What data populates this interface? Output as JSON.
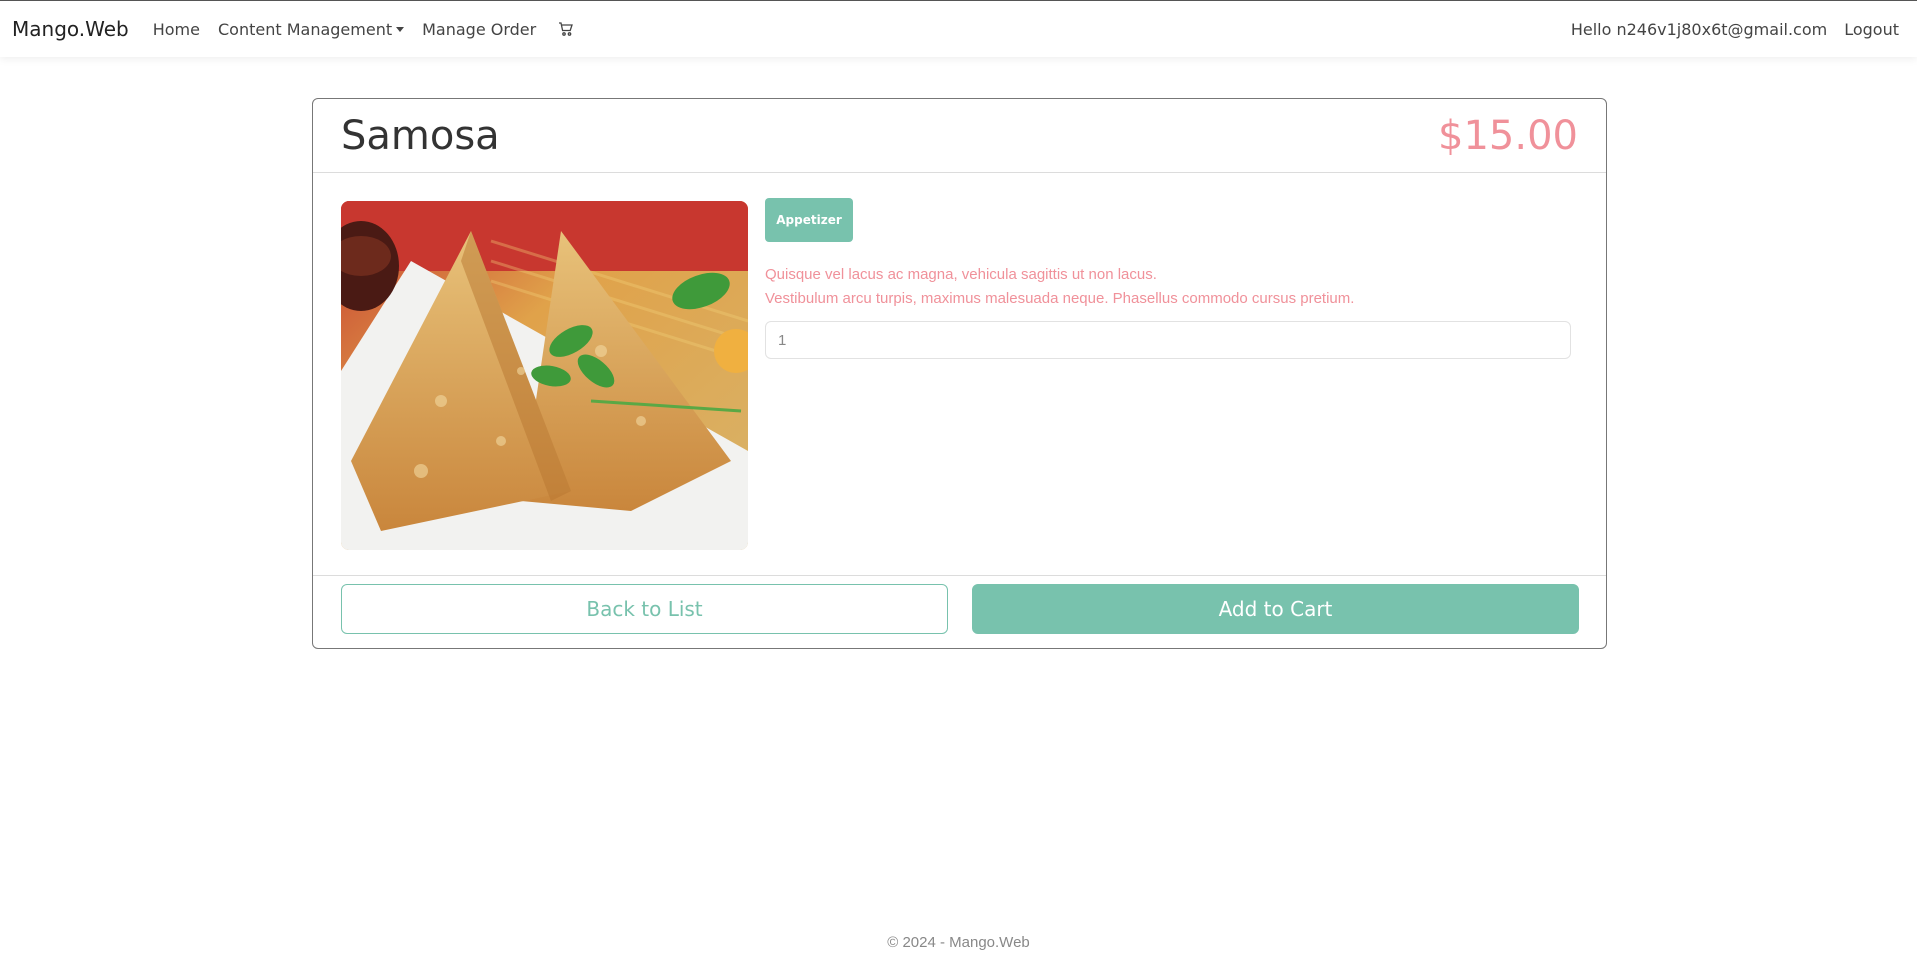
{
  "navbar": {
    "brand": "Mango.Web",
    "items": [
      {
        "label": "Home"
      },
      {
        "label": "Content Management"
      },
      {
        "label": "Manage Order"
      }
    ],
    "cart_icon": "cart-icon",
    "greeting": "Hello n246v1j80x6t@gmail.com",
    "logout": "Logout"
  },
  "product": {
    "name": "Samosa",
    "price": "$15.00",
    "category": "Appetizer",
    "description_lines": [
      "Quisque vel lacus ac magna, vehicula sagittis ut non lacus.",
      "Vestibulum arcu turpis, maximus malesuada neque. Phasellus commodo cursus pretium."
    ],
    "quantity": "1"
  },
  "buttons": {
    "back": "Back to List",
    "add": "Add to Cart"
  },
  "footer": {
    "text": "© 2024 - Mango.Web"
  },
  "colors": {
    "accent": "#78c2ad",
    "price": "#f0919a"
  }
}
